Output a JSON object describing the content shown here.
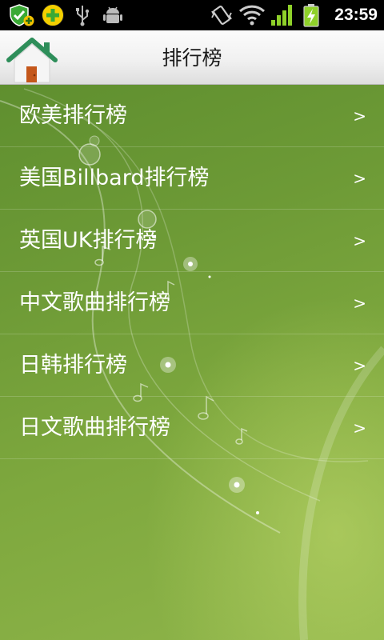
{
  "status_bar": {
    "time": "23:59",
    "icons": [
      "shield-check-icon",
      "plus-app-icon",
      "usb-icon",
      "android-debug-icon",
      "vibrate-icon",
      "wifi-icon",
      "signal-icon",
      "battery-charging-icon"
    ]
  },
  "header": {
    "title": "排行榜",
    "home_icon": "home-icon"
  },
  "list": {
    "items": [
      {
        "label": "欧美排行榜",
        "arrow": ">"
      },
      {
        "label": "美国Billbard排行榜",
        "arrow": ">"
      },
      {
        "label": "英国UK排行榜",
        "arrow": ">"
      },
      {
        "label": "中文歌曲排行榜",
        "arrow": ">"
      },
      {
        "label": "日韩排行榜",
        "arrow": ">"
      },
      {
        "label": "日文歌曲排行榜",
        "arrow": ">"
      }
    ]
  },
  "colors": {
    "status_bar_bg": "#000000",
    "title_bar_bg": "#f1f1f1",
    "content_bg": "#6d9a36",
    "list_text": "#ffffff"
  }
}
